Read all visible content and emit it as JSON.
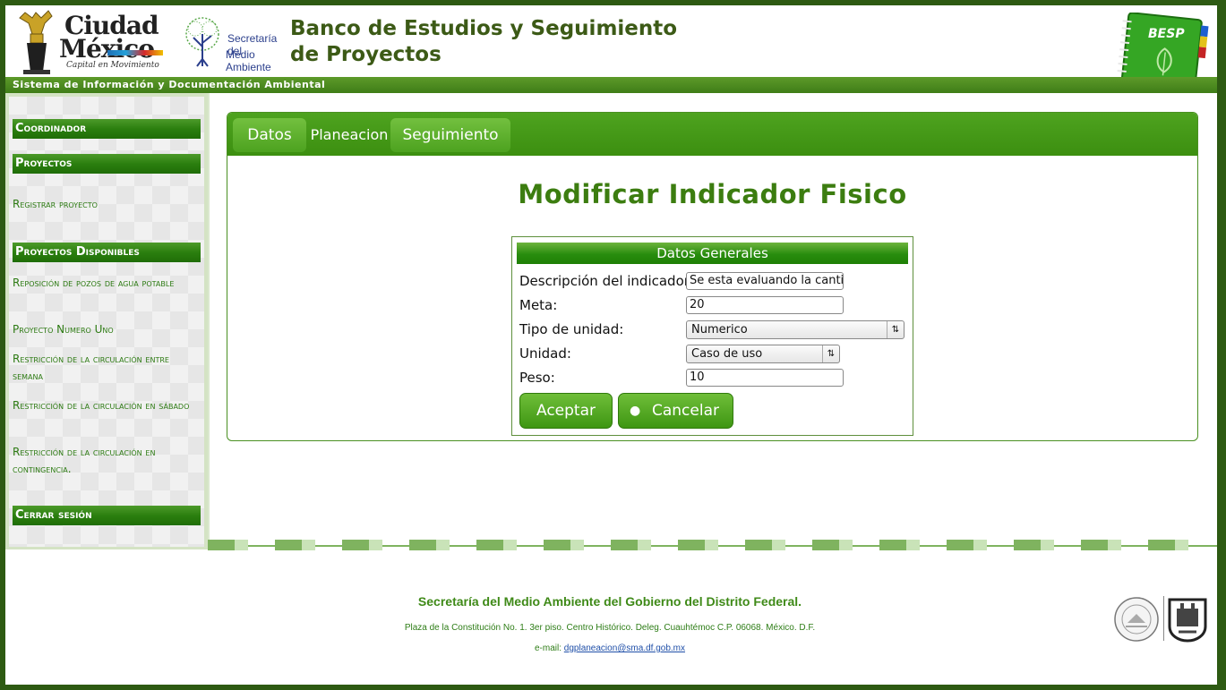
{
  "header": {
    "logo_line1": "Ciudad",
    "logo_line2": "México",
    "logo_tagline": "Capital en Movimiento",
    "sma_line1": "Secretaría del",
    "sma_line2": "Medio Ambiente",
    "title": "Banco de Estudios y Seguimiento de Proyectos",
    "badge": "BESP",
    "subtitle": "Sistema de Información y Documentación Ambiental"
  },
  "sidebar": {
    "coordinator": "Coordinador",
    "projects": "Proyectos",
    "register": "Registrar proyecto",
    "available": "Proyectos Disponibles",
    "items": [
      {
        "label": "Reposición de pozos de agua potable"
      },
      {
        "label": "Proyecto Numero Uno"
      },
      {
        "label": "Restricción de la circulación entre semana"
      },
      {
        "label": "Restricción de la circulación en sábado"
      },
      {
        "label": "Restricción de la circulación en contingencia."
      }
    ],
    "logout": "Cerrar sesión"
  },
  "tabs": {
    "datos": "Datos",
    "planeacion": "Planeacion",
    "seguimiento": "Seguimiento"
  },
  "page_title": "Modificar Indicador Fisico",
  "form": {
    "header": "Datos Generales",
    "descripcion_label": "Descripción del indicador",
    "descripcion_value": "Se esta evaluando la cantidad",
    "meta_label": "Meta:",
    "meta_value": "20",
    "tipo_label": "Tipo de unidad:",
    "tipo_value": "Numerico",
    "unidad_label": "Unidad:",
    "unidad_value": "Caso de uso",
    "peso_label": "Peso:",
    "peso_value": "10",
    "accept": "Aceptar",
    "cancel": "Cancelar"
  },
  "footer": {
    "line1": "Secretaría del Medio Ambiente del Gobierno del Distrito Federal.",
    "line2": "Plaza de la Constitución No. 1. 3er piso. Centro Histórico. Deleg. Cuauhtémoc C.P. 06068. México. D.F.",
    "email_label": "e-mail:",
    "email": "dgplaneacion@sma.df.gob.mx"
  },
  "colors": {
    "brand_green": "#3c8f10",
    "dark_frame": "#2d5a12",
    "link_green": "#2c7a12"
  }
}
